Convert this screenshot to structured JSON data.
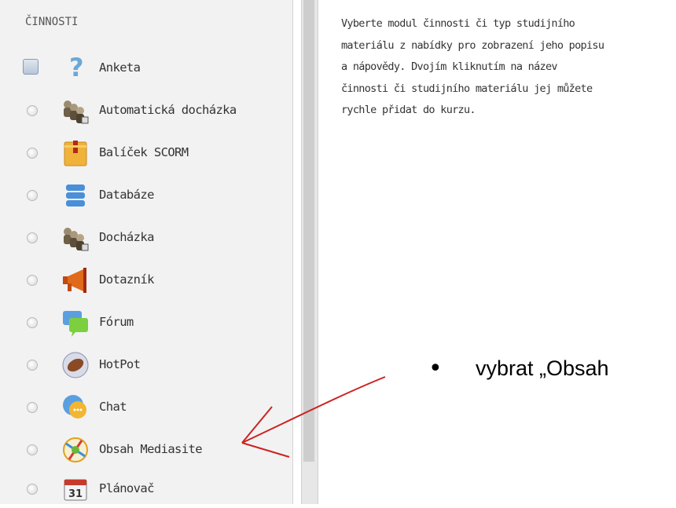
{
  "panel": {
    "section_title": "ČINNOSTI",
    "items": [
      {
        "label": "Anketa",
        "icon": "question-icon",
        "selected": true
      },
      {
        "label": "Automatická docházka",
        "icon": "people-icon",
        "selected": false
      },
      {
        "label": "Balíček SCORM",
        "icon": "package-icon",
        "selected": false
      },
      {
        "label": "Databáze",
        "icon": "database-icon",
        "selected": false
      },
      {
        "label": "Docházka",
        "icon": "people-icon",
        "selected": false
      },
      {
        "label": "Dotazník",
        "icon": "megaphone-icon",
        "selected": false
      },
      {
        "label": "Fórum",
        "icon": "forum-icon",
        "selected": false
      },
      {
        "label": "HotPot",
        "icon": "hotpot-icon",
        "selected": false
      },
      {
        "label": "Chat",
        "icon": "chat-icon",
        "selected": false
      },
      {
        "label": "Obsah Mediasite",
        "icon": "mediasite-icon",
        "selected": false
      },
      {
        "label": "Plánovač",
        "icon": "calendar-icon",
        "selected": false
      }
    ]
  },
  "calendar_icon_number": "31",
  "help": {
    "lines": [
      "Vyberte modul činnosti či typ studijního",
      "materiálu z nabídky pro zobrazení jeho popisu",
      "a nápovědy. Dvojím kliknutím na název",
      "činnosti či studijního materiálu jej můžete",
      "rychle přidat do kurzu."
    ]
  },
  "annotation": {
    "bullet": "•",
    "text": "vybrat „Obsah",
    "arrow_color": "#cc2222"
  }
}
